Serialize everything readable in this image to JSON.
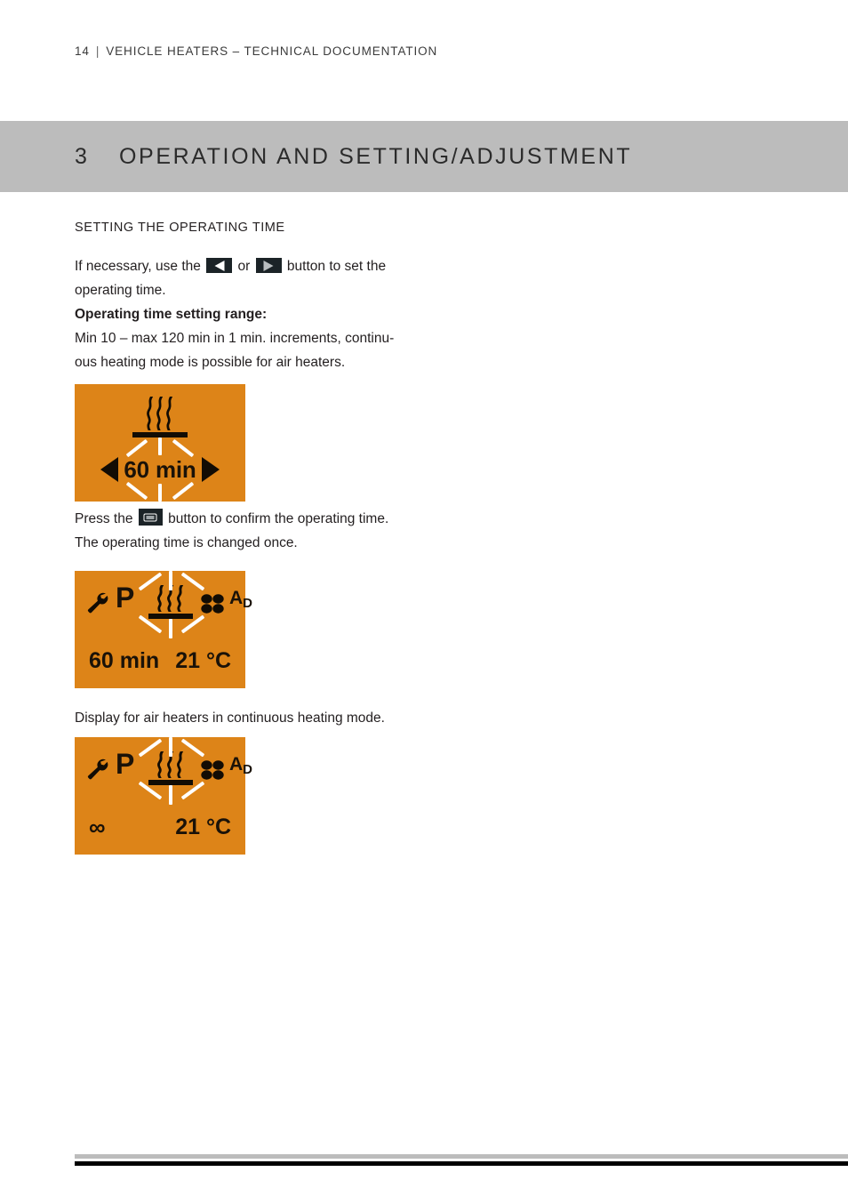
{
  "header": {
    "page_number": "14",
    "separator": "|",
    "document_title": "VEHICLE HEATERS – TECHNICAL DOCUMENTATION"
  },
  "chapter": {
    "number": "3",
    "title": "OPERATION AND SETTING/ADJUSTMENT",
    "band_color": "#bcbcbc"
  },
  "body": {
    "subhead": "SETTING THE OPERATING TIME",
    "intro_before_left_key": "If necessary, use the",
    "intro_between_keys": "or",
    "intro_after_right_key": "button to set the",
    "intro_line2": "operating time.",
    "range_heading": "Operating time setting range:",
    "range_line1": "Min 10 – max 120 min in 1 min. increments, continu-",
    "range_line2": "ous heating mode is possible for air heaters.",
    "confirm_before_key": "Press the",
    "confirm_after_key": "button to confirm the operating time.",
    "confirm_line2": "The operating time is changed once.",
    "continuous_caption": "Display for air heaters in continuous heating mode."
  },
  "keys": {
    "left_icon": "arrow-left-icon",
    "right_icon": "arrow-right-icon",
    "confirm_icon": "confirm-button-icon"
  },
  "displays": {
    "accent_color": "#dd8418",
    "panel1": {
      "name": "operating-time-blinking-display",
      "heater_icon": "heater-element-icon",
      "blink_rays": "blink-rays-indicator",
      "arrow_left": "arrow-left-icon",
      "arrow_right": "arrow-right-icon",
      "value": "60 min"
    },
    "panel2": {
      "name": "operating-status-display",
      "wrench_icon": "wrench-icon",
      "preheat_label": "P",
      "heater_icon": "heater-element-icon",
      "fan_icon": "fan-icon",
      "mode_label": "A",
      "mode_sub": "D",
      "time_value": "60 min",
      "temperature_value": "21 °C"
    },
    "panel3": {
      "name": "continuous-heating-display",
      "wrench_icon": "wrench-icon",
      "preheat_label": "P",
      "heater_icon": "heater-element-icon",
      "fan_icon": "fan-icon",
      "mode_label": "A",
      "mode_sub": "D",
      "time_value": "∞",
      "temperature_value": "21 °C"
    }
  }
}
